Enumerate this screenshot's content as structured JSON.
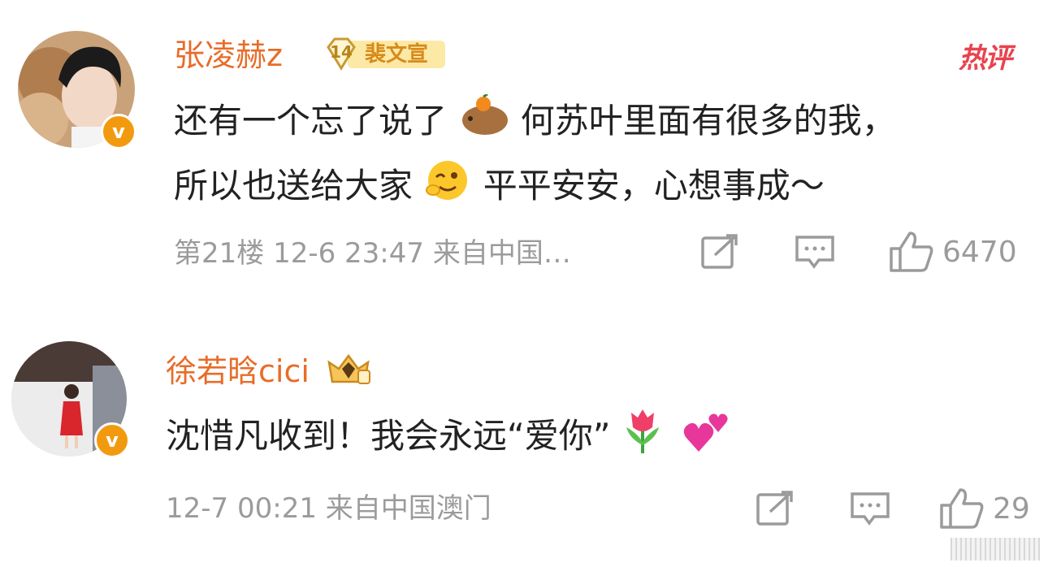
{
  "comments": [
    {
      "username": "张凌赫z",
      "fan_badge": {
        "level": "14",
        "name": "裴文宣"
      },
      "hot_label": "热评",
      "line1_a": "还有一个忘了说了",
      "line1_b": "何苏叶里面有很多的我，",
      "line2_a": "所以也送给大家",
      "line2_b": "平平安安，心想事成～",
      "meta": "第21楼 12-6 23:47 来自中国…",
      "likes": "6470",
      "verified_icon": "v-badge-icon"
    },
    {
      "username": "徐若晗cici",
      "text_a": "沈惜凡收到！我会永远“爱你”",
      "meta": "12-7 00:21 来自中国澳门",
      "likes": "29",
      "verified_icon": "v-badge-icon"
    }
  ],
  "colors": {
    "username": "#e86c29",
    "body_text": "#222222",
    "meta_text": "#9b9b9b",
    "hot_label": "#e8434f",
    "verified": "#f29a0f"
  }
}
